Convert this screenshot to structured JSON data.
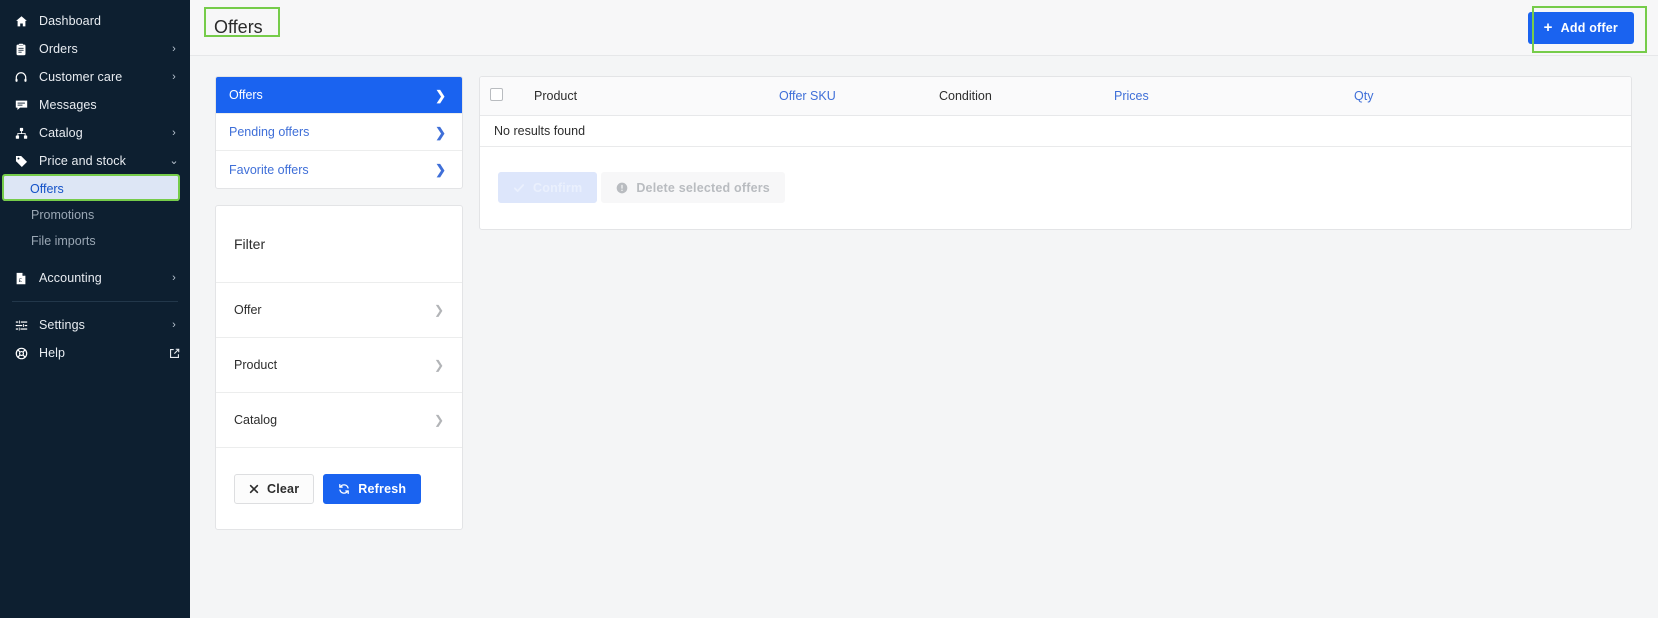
{
  "sidebar": {
    "items": [
      {
        "label": "Dashboard",
        "icon": "home-icon",
        "chevron": false
      },
      {
        "label": "Orders",
        "icon": "clipboard-icon",
        "chevron": true
      },
      {
        "label": "Customer care",
        "icon": "headset-icon",
        "chevron": true
      },
      {
        "label": "Messages",
        "icon": "message-icon",
        "chevron": false
      },
      {
        "label": "Catalog",
        "icon": "sitemap-icon",
        "chevron": true
      },
      {
        "label": "Price and stock",
        "icon": "tag-icon",
        "chevron": true,
        "expanded": true
      }
    ],
    "sub_items": [
      {
        "label": "Offers",
        "active": true
      },
      {
        "label": "Promotions",
        "active": false
      },
      {
        "label": "File imports",
        "active": false
      }
    ],
    "accounting": {
      "label": "Accounting",
      "icon": "invoice-icon",
      "chevron": true
    },
    "footer_items": [
      {
        "label": "Settings",
        "icon": "sliders-icon",
        "chevron": true,
        "external": false
      },
      {
        "label": "Help",
        "icon": "lifebuoy-icon",
        "chevron": false,
        "external": true
      }
    ]
  },
  "header": {
    "title": "Offers",
    "add_offer_label": "Add offer",
    "add_offer_icon": "plus-icon"
  },
  "nav_card": {
    "rows": [
      {
        "label": "Offers",
        "selected": true
      },
      {
        "label": "Pending offers",
        "selected": false
      },
      {
        "label": "Favorite offers",
        "selected": false
      }
    ]
  },
  "filter": {
    "title": "Filter",
    "rows": [
      {
        "label": "Offer"
      },
      {
        "label": "Product"
      },
      {
        "label": "Catalog"
      }
    ],
    "clear_label": "Clear",
    "clear_icon": "close-icon",
    "refresh_label": "Refresh",
    "refresh_icon": "refresh-icon"
  },
  "table": {
    "columns": [
      {
        "label": "Product",
        "link": false
      },
      {
        "label": "Offer SKU",
        "link": true
      },
      {
        "label": "Condition",
        "link": false
      },
      {
        "label": "Prices",
        "link": true
      },
      {
        "label": "Qty",
        "link": true
      }
    ],
    "empty_message": "No results found",
    "select_all_checkbox": "unchecked"
  },
  "table_actions": {
    "confirm_label": "Confirm",
    "confirm_icon": "check-icon",
    "delete_label": "Delete selected offers",
    "delete_icon": "info-icon"
  },
  "colors": {
    "sidebar_bg": "#0d1f30",
    "accent_blue": "#1a63f0",
    "link_blue": "#3f6fd8",
    "highlight_green": "#76cc4a",
    "page_bg": "#f4f5f6"
  }
}
